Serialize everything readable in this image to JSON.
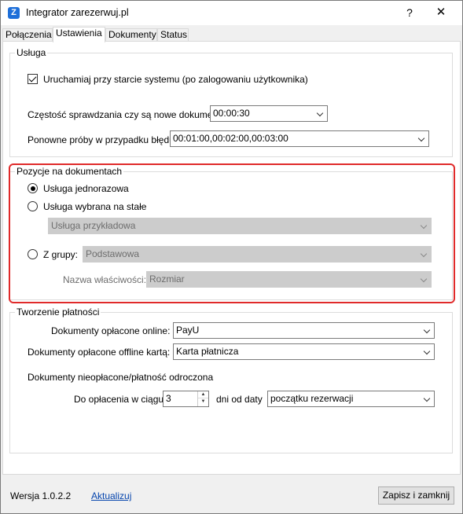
{
  "window": {
    "title": "Integrator zarezerwuj.pl",
    "icon_letter": "Z",
    "help": "?",
    "close": "✕"
  },
  "tabs": [
    {
      "label": "Połączenia",
      "active": false
    },
    {
      "label": "Ustawienia",
      "active": true
    },
    {
      "label": "Dokumenty",
      "active": false
    },
    {
      "label": "Status",
      "active": false
    }
  ],
  "service": {
    "title": "Usługa",
    "autostart_label": "Uruchamiaj przy starcie systemu (po zalogowaniu użytkownika)",
    "autostart_checked": true,
    "frequency_label": "Częstość sprawdzania czy są nowe dokumenty",
    "frequency_value": "00:00:30",
    "retry_label": "Ponowne próby w przypadku błędu:",
    "retry_value": "00:01:00,00:02:00,00:03:00"
  },
  "positions": {
    "title": "Pozycje na dokumentach",
    "option_one_time": "Usługa jednorazowa",
    "option_fixed": "Usługa wybrana na stałe",
    "fixed_value": "Usługa przykładowa",
    "option_group": "Z grupy:",
    "group_value": "Podstawowa",
    "property_label": "Nazwa właściwości:",
    "property_value": "Rozmiar",
    "selected": "one_time",
    "highlight_color": "#e02a2a"
  },
  "payments": {
    "title": "Tworzenie płatności",
    "online_label": "Dokumenty opłacone online:",
    "online_value": "PayU",
    "offline_label": "Dokumenty opłacone offline kartą:",
    "offline_value": "Karta płatnicza",
    "unpaid_label": "Dokumenty nieopłacone/płatność odroczona",
    "due_label": "Do opłacenia w ciągu",
    "due_value": "3",
    "days_label": "dni od daty",
    "date_value": "początku rezerwacji"
  },
  "footer": {
    "version": "Wersja 1.0.2.2",
    "update_link": "Aktualizuj",
    "save_close": "Zapisz i zamknij"
  }
}
